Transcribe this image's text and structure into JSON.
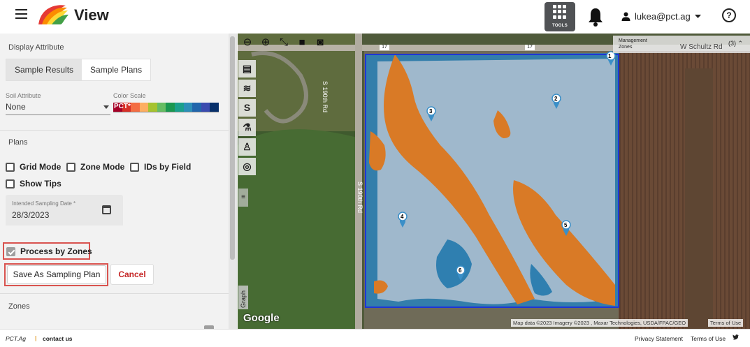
{
  "header": {
    "title": "View",
    "tools_label": "TOOLS",
    "user": "lukea@pct.ag",
    "help_glyph": "?"
  },
  "panel": {
    "display_attribute": "Display Attribute",
    "tabs": [
      {
        "label": "Sample Results",
        "active": true
      },
      {
        "label": "Sample Plans",
        "active": false
      }
    ],
    "soil_attribute": {
      "label": "Soil Attribute",
      "value": "None"
    },
    "color_scale": {
      "label": "Color Scale",
      "text": "PCT*",
      "colors": [
        "#a50026",
        "#d73027",
        "#f46d43",
        "#fdae61",
        "#a6c32f",
        "#66bd63",
        "#1a9850",
        "#1aa08c",
        "#2c8fb8",
        "#2166ac",
        "#3b4bb0",
        "#08306b"
      ]
    },
    "plans_label": "Plans",
    "checkboxes": [
      {
        "label": "Grid Mode",
        "checked": false
      },
      {
        "label": "Zone Mode",
        "checked": false
      },
      {
        "label": "IDs by Field",
        "checked": false
      },
      {
        "label": "Show Tips",
        "checked": false
      }
    ],
    "date": {
      "label": "Intended Sampling Date *",
      "value": "28/3/2023"
    },
    "process_by_zones": {
      "label": "Process by Zones",
      "checked": true
    },
    "save_label": "Save As Sampling Plan",
    "cancel_label": "Cancel",
    "zones_label": "Zones"
  },
  "map": {
    "road_labels": [
      "S 190th Rd",
      "S 190th Rd",
      "W Schultz Rd"
    ],
    "route_badge": "17",
    "mgmt_title_line1": "Management",
    "mgmt_title_line2": "Zones",
    "mgmt_count": "(3)",
    "graph_label": "Graph",
    "google": "Google",
    "attribution": "Map data ©2023 Imagery ©2023 , Maxar Technologies, USDA/FPAC/GEO",
    "terms": "Terms of Use",
    "markers": [
      "1",
      "2",
      "3",
      "4",
      "5",
      "6"
    ]
  },
  "footer": {
    "brand": "PCT.Ag",
    "separator": "|",
    "contact": "contact us",
    "privacy": "Privacy Statement",
    "terms": "Terms of Use"
  },
  "colors": {
    "highlight": "#d9534f",
    "zone_orange": "#d97a26",
    "zone_blue": "#2f7fb0",
    "zone_light": "#9fb8cc",
    "boundary": "#1f35d6"
  }
}
